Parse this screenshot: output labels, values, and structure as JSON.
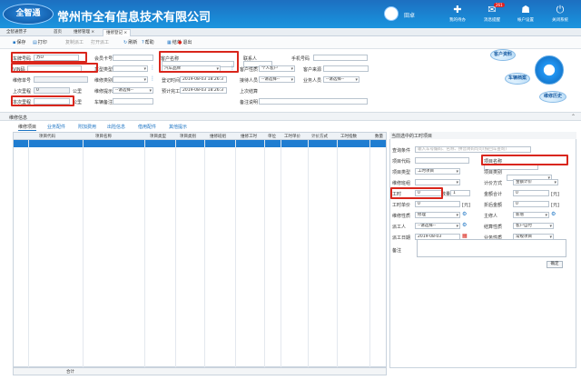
{
  "app": {
    "logo": "全智通",
    "title": "常州市全有信息技术有限公司",
    "user": "田卓"
  },
  "header_buttons": [
    {
      "label": "我的待办",
      "icon": "bell-icon",
      "glyph": "✚"
    },
    {
      "label": "消息提醒",
      "icon": "envelope-icon",
      "glyph": "✉",
      "badge": "261"
    },
    {
      "label": "帐户设置",
      "icon": "user-icon",
      "glyph": "☗"
    },
    {
      "label": "关闭系统",
      "icon": "power-icon",
      "glyph": "⏻"
    }
  ],
  "tabs": [
    "全智通营子",
    "首页",
    "维修管理 ×",
    "维修登记 ×"
  ],
  "toolbar": {
    "save": "保存",
    "print": "打印",
    "copy": "复制派工",
    "open": "打开派工",
    "refresh": "刷新",
    "help": "帮助",
    "close_order": "结单",
    "exit": "退出"
  },
  "form": {
    "plate_label": "车牌号码",
    "plate_value": "苏O",
    "card_label": "会员卡号",
    "customer_name_label": "客户名称",
    "contact_label": "联系人",
    "mobile_label": "手机号码",
    "vin_label": "VIN码",
    "model_label": "车型类型",
    "repair_type_label": "维修类型",
    "repair_type_value": "汽车品牌",
    "customer_prop_label": "客户性质",
    "customer_prop_value": "个人客户",
    "customer_source_label": "客户来源",
    "order_no_label": "维修单号",
    "order_cat_label": "维修类别",
    "register_label": "登记时间",
    "register_value": "2019-08-03 18:26:3",
    "receiver_label": "接待人员",
    "receiver_value": "--请选择--",
    "business_label": "业务人员",
    "business_value": "--请选择--",
    "last_mileage_label": "上次里程",
    "last_mileage_value": "0",
    "km": "公里",
    "maintain_label": "维修提示",
    "maintain_value": "--请选择--",
    "planned_label": "预计完工",
    "planned_value": "2019-08-03 18:26:3",
    "last_settle_label": "上次结算",
    "mileage_label": "本次里程",
    "engine_label": "车辆备注",
    "settle_remark_label": "备注说明",
    "fault_label": "故障描述"
  },
  "circles": {
    "customer_archive": "客户资料",
    "vehicle_archive": "车辆档案",
    "repair_history": "维修历史"
  },
  "section_title": "维修信息",
  "subtabs": [
    "维修项目",
    "业务配件",
    "附加费用",
    "出险信息",
    "借用配件",
    "其他提示"
  ],
  "grid": {
    "headers": [
      "项目代码",
      "项目名称",
      "项目类型",
      "项目类别",
      "维修班组",
      "维修工时",
      "单位",
      "工时单价",
      "计价方式",
      "工时指数",
      "数量"
    ],
    "footer_label": "合计"
  },
  "right_panel": {
    "title": "当前选中的工时项目",
    "search_label": "查询条件",
    "search_placeholder": "输入车号编码、名称、拼音简码均可(按回车查询)",
    "code_label": "项目代码",
    "name_label": "项目名称",
    "type_label": "项目类型",
    "type_value": "工时项目",
    "category_label": "项目类别",
    "team_label": "维修班组",
    "pricing_label": "计价方式",
    "pricing_value": "金额计价",
    "hours_label": "工时",
    "hours_value": "0",
    "qty_label": "数量",
    "qty_value": "1",
    "amount_label": "金额合计",
    "amount_value": "0",
    "price_label": "工时单价",
    "price_value": "0",
    "unit_yuan": "[元]",
    "discount_label": "折后金额",
    "discount_value": "0",
    "mode_label": "维修性质",
    "mode_value": "修理",
    "owner_label": "主修人",
    "owner_value": "新增",
    "worker_label": "派工人",
    "worker_value": "--请选择--",
    "payer_label": "结算性质",
    "payer_value": "客户自付",
    "date_label": "派工日期",
    "date_value": "2019-08-03",
    "business_label": "业务性质",
    "business_value": "常规项目",
    "remark_label": "备注",
    "ok": "确定"
  }
}
